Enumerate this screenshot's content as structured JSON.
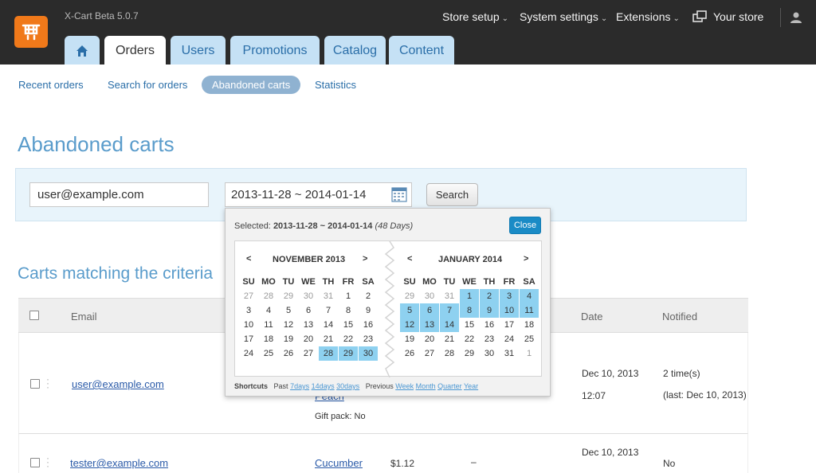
{
  "app": {
    "version": "X-Cart Beta 5.0.7"
  },
  "tabs": [
    {
      "label": "Orders"
    },
    {
      "label": "Users"
    },
    {
      "label": "Promotions"
    },
    {
      "label": "Catalog"
    },
    {
      "label": "Content"
    }
  ],
  "topmenu": {
    "store_setup": "Store setup",
    "system_settings": "System settings",
    "extensions": "Extensions",
    "your_store": "Your store",
    "chevron": "⌄"
  },
  "subnav": [
    {
      "label": "Recent orders"
    },
    {
      "label": "Search for orders"
    },
    {
      "label": "Abandoned carts"
    },
    {
      "label": "Statistics"
    }
  ],
  "page": {
    "title": "Abandoned carts"
  },
  "search": {
    "email_value": "user@example.com",
    "date_range": "2013-11-28 ~ 2014-01-14",
    "button": "Search"
  },
  "section": {
    "title": "Carts matching the criteria"
  },
  "table": {
    "headers": {
      "email": "Email",
      "date": "Date",
      "notified": "Notified"
    },
    "rows": [
      {
        "email": "user@example.com",
        "product_tail": "Peach",
        "gift": "Gift pack: No",
        "date": "Dec 10, 2013",
        "time": "12:07",
        "notified": "2 time(s)",
        "notified_last": "(last: Dec 10, 2013)"
      },
      {
        "email": "tester@example.com",
        "product": "Cucumber",
        "price": "$1.12",
        "dash": "–",
        "date": "Dec 10, 2013",
        "notified": "No"
      }
    ]
  },
  "datepicker": {
    "selected_label": "Selected:",
    "selected_range": "2013-11-28 ~ 2014-01-14",
    "selected_days": "(48 Days)",
    "close": "Close",
    "prev": "<",
    "next": ">",
    "weekdays": [
      "SU",
      "MO",
      "TU",
      "WE",
      "TH",
      "FR",
      "SA"
    ],
    "left_month": "NOVEMBER 2013",
    "right_month": "JANUARY 2014",
    "left_days": [
      [
        "27",
        "28",
        "29",
        "30",
        "31",
        "1",
        "2"
      ],
      [
        "3",
        "4",
        "5",
        "6",
        "7",
        "8",
        "9"
      ],
      [
        "10",
        "11",
        "12",
        "13",
        "14",
        "15",
        "16"
      ],
      [
        "17",
        "18",
        "19",
        "20",
        "21",
        "22",
        "23"
      ],
      [
        "24",
        "25",
        "26",
        "27",
        "28",
        "29",
        "30"
      ]
    ],
    "right_days": [
      [
        "29",
        "30",
        "31",
        "1",
        "2",
        "3",
        "4"
      ],
      [
        "5",
        "6",
        "7",
        "8",
        "9",
        "10",
        "11"
      ],
      [
        "12",
        "13",
        "14",
        "15",
        "16",
        "17",
        "18"
      ],
      [
        "19",
        "20",
        "21",
        "22",
        "23",
        "24",
        "25"
      ],
      [
        "26",
        "27",
        "28",
        "29",
        "30",
        "31",
        "1"
      ]
    ],
    "shortcuts_label": "Shortcuts",
    "past_label": "Past",
    "past_links": [
      "7days",
      "14days",
      "30days"
    ],
    "previous_label": "Previous",
    "previous_links": [
      "Week",
      "Month",
      "Quarter",
      "Year"
    ],
    "highlight_color": "#8ed1f0"
  },
  "colors": {
    "accent": "#5a9ccb",
    "topbar": "#2b2b2b",
    "logo": "#f0791a",
    "tab": "#c5e1f5"
  }
}
